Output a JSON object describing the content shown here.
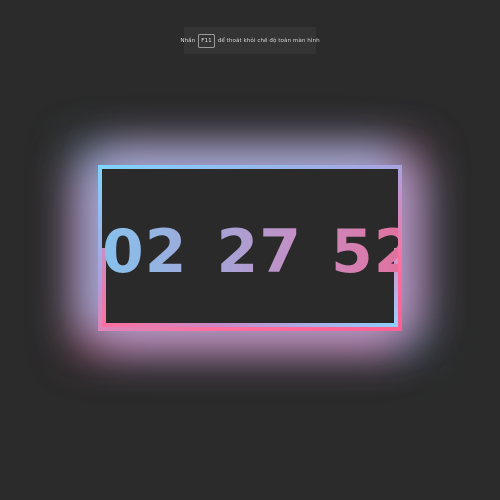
{
  "toast": {
    "prefix": "Nhấn",
    "key": "F11",
    "suffix": "để thoát khỏi chế độ toàn màn hình"
  },
  "clock": {
    "hours": "02",
    "minutes": "27",
    "seconds": "52",
    "separator": ":"
  },
  "colors": {
    "background": "#2b2b2b",
    "frame_blue": "#7fd4ff",
    "frame_pink": "#ff6f9e",
    "digit_start": "#86c2ec",
    "digit_end": "#e0729f"
  }
}
